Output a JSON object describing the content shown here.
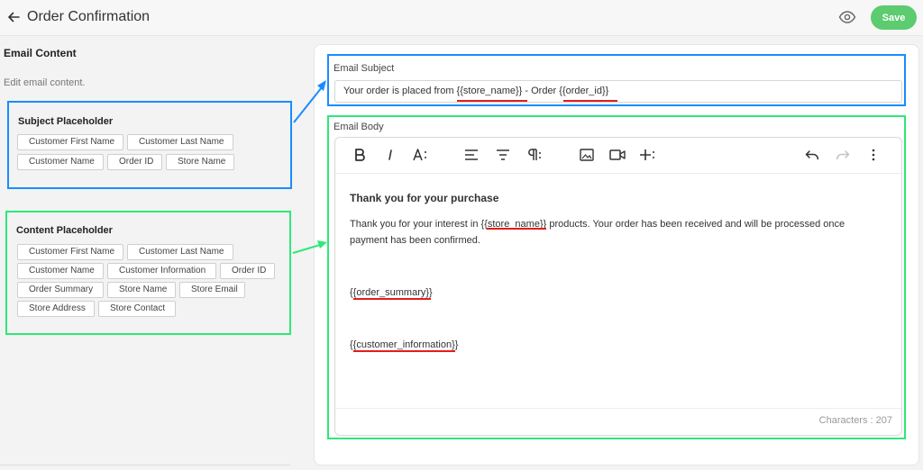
{
  "header": {
    "title": "Order Confirmation",
    "save_label": "Save"
  },
  "left": {
    "section_title": "Email Content",
    "section_desc": "Edit email content.",
    "subject_placeholder": {
      "title": "Subject Placeholder",
      "chips": [
        "Customer First Name",
        "Customer Last Name",
        "Customer Name",
        "Order ID",
        "Store Name"
      ]
    },
    "content_placeholder": {
      "title": "Content Placeholder",
      "chips": [
        "Customer First Name",
        "Customer Last Name",
        "Customer Name",
        "Customer Information",
        "Order ID",
        "Order Summary",
        "Store Name",
        "Store Email",
        "Store Address",
        "Store Contact"
      ]
    }
  },
  "email_subject": {
    "label": "Email Subject",
    "value": "Your order is placed from {{store_name}} - Order {{order_id}}"
  },
  "email_body": {
    "label": "Email Body",
    "heading": "Thank you for your purchase",
    "paragraph_line1": "Thank you for your interest in {{store_name}} products. Your order has been received and will be processed once",
    "paragraph_line2": "payment has been confirmed.",
    "order_summary": "{{order_summary}}",
    "customer_information": "{{customer_information}}",
    "char_count": "Characters : 207"
  },
  "icons": {
    "back": "arrow-left-icon",
    "preview": "eye-icon",
    "bold": "bold-icon",
    "italic": "italic-icon",
    "font_size": "font-size-icon",
    "align_left": "align-left-icon",
    "align_center": "align-center-icon",
    "paragraph": "paragraph-icon",
    "image": "image-icon",
    "video": "video-icon",
    "insert": "plus-more-icon",
    "undo": "undo-icon",
    "redo": "redo-icon",
    "more": "more-vertical-icon"
  },
  "colors": {
    "save_button": "#5dcb6f",
    "subject_highlight": "#1a8cff",
    "content_highlight": "#2ee878",
    "underline": "#e31d1d"
  }
}
